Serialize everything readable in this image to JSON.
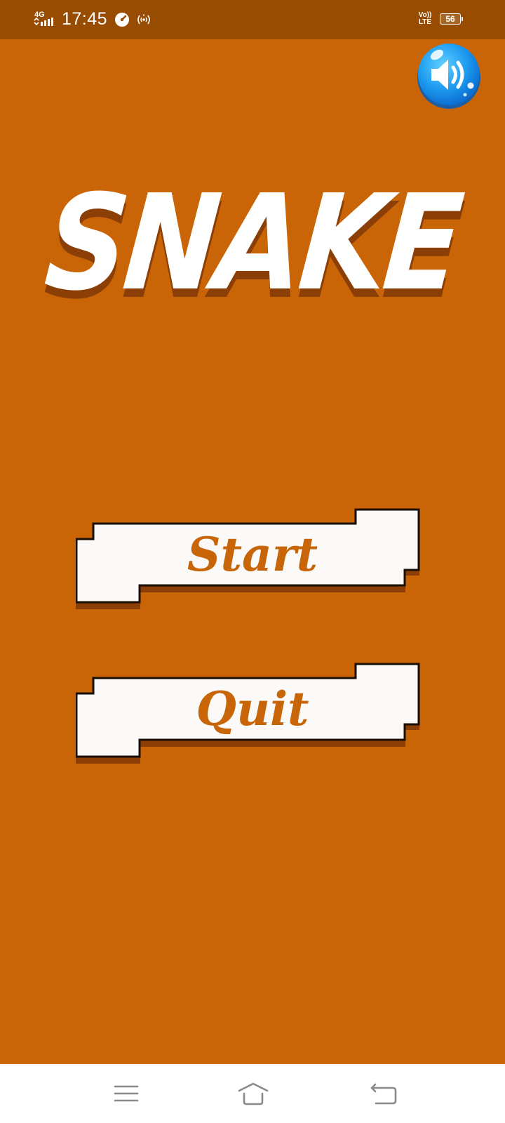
{
  "status_bar": {
    "network_type": "4G",
    "time": "17:45",
    "volte_label": "Vo))\nLTE",
    "battery_level": "56",
    "background_color": "#974c02",
    "icons": [
      "signal-icon",
      "speedometer-icon",
      "hotspot-icon",
      "battery-icon"
    ]
  },
  "game": {
    "title": "SNAKE",
    "background_color": "#c96506",
    "sound_button_icon": "speaker-icon",
    "sound_button_color": "#1e9bf0",
    "menu": {
      "start_label": "Start",
      "quit_label": "Quit",
      "label_color": "#c76508",
      "button_fill": "#fbfaf9"
    }
  },
  "navigation_bar": {
    "icons": [
      "menu-icon",
      "home-icon",
      "back-icon"
    ]
  }
}
